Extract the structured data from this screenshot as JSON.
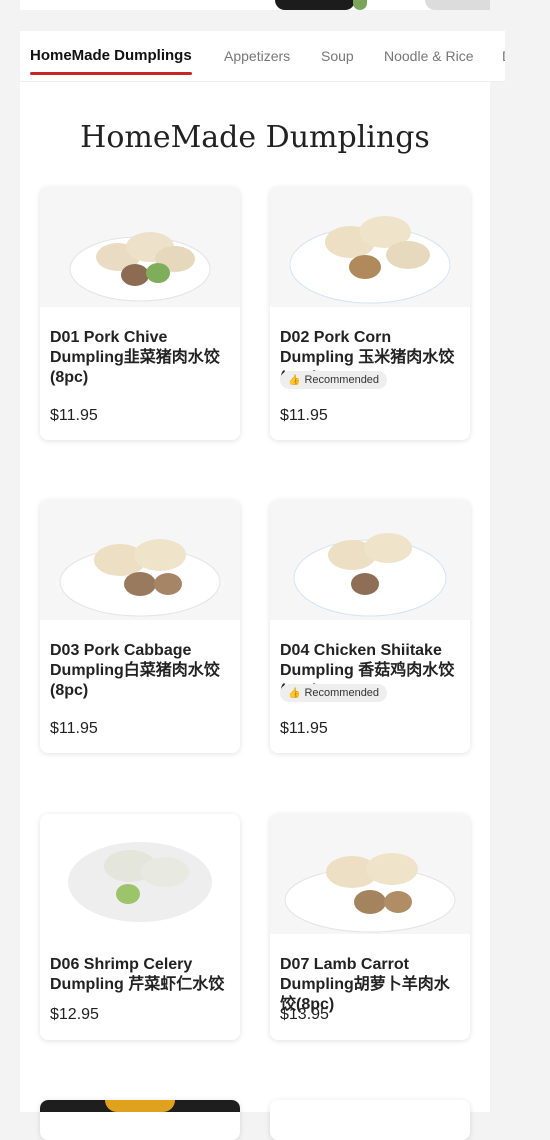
{
  "tabs": [
    "HomeMade Dumplings",
    "Appetizers",
    "Soup",
    "Noodle & Rice",
    "D"
  ],
  "section_title": "HomeMade Dumplings",
  "badge_text": "Recommended",
  "badge_icon": "thumbs-up-icon",
  "items": [
    {
      "name": "D01 Pork Chive Dumpling韭菜猪肉水饺(8pc)",
      "price": "$11.95",
      "recommended": false
    },
    {
      "name": "D02 Pork Corn Dumpling 玉米猪肉水饺(8pc)",
      "price": "$11.95",
      "recommended": true
    },
    {
      "name": "D03 Pork Cabbage Dumpling白菜猪肉水饺(8pc)",
      "price": "$11.95",
      "recommended": false
    },
    {
      "name": "D04 Chicken Shiitake Dumpling 香菇鸡肉水饺(8pc)",
      "price": "$11.95",
      "recommended": true
    },
    {
      "name": "D06 Shrimp Celery Dumpling 芹菜虾仁水饺",
      "price": "$12.95",
      "recommended": false
    },
    {
      "name": "D07 Lamb Carrot Dumpling胡萝卜羊肉水饺(8pc)",
      "price": "$13.95",
      "recommended": false
    }
  ],
  "colors": {
    "accent": "#c62828",
    "background": "#f3f3f3"
  }
}
